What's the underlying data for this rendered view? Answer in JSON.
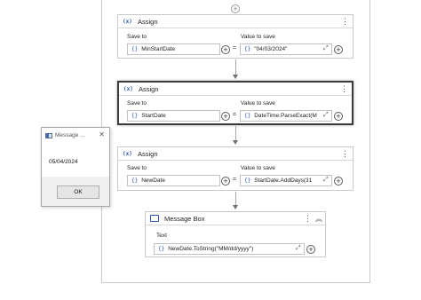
{
  "assign1": {
    "title": "Assign",
    "icon": "(x)",
    "save_to_label": "Save to",
    "value_label": "Value to save",
    "save_to_value": "MinStartDate",
    "value": "\"04/03/2024\""
  },
  "assign2": {
    "title": "Assign",
    "icon": "(x)",
    "save_to_label": "Save to",
    "value_label": "Value to save",
    "save_to_value": "StartDate",
    "value": "DateTime.ParseExact(M"
  },
  "assign3": {
    "title": "Assign",
    "icon": "(x)",
    "save_to_label": "Save to",
    "value_label": "Value to save",
    "save_to_value": "NewDate",
    "value": "StartDate.AddDays(31"
  },
  "message_box_activity": {
    "title": "Message Box",
    "text_label": "Text",
    "text_value": "NewDate.ToString(\"MM/dd/yyyy\")"
  },
  "dialog": {
    "title": "Message ...",
    "message": "05/04/2024",
    "ok_label": "OK"
  },
  "common": {
    "brace": "{}",
    "equals": "=",
    "plus": "+",
    "kebab": "⋮",
    "expand": "⤢",
    "collapse": "«",
    "close": "✕"
  }
}
